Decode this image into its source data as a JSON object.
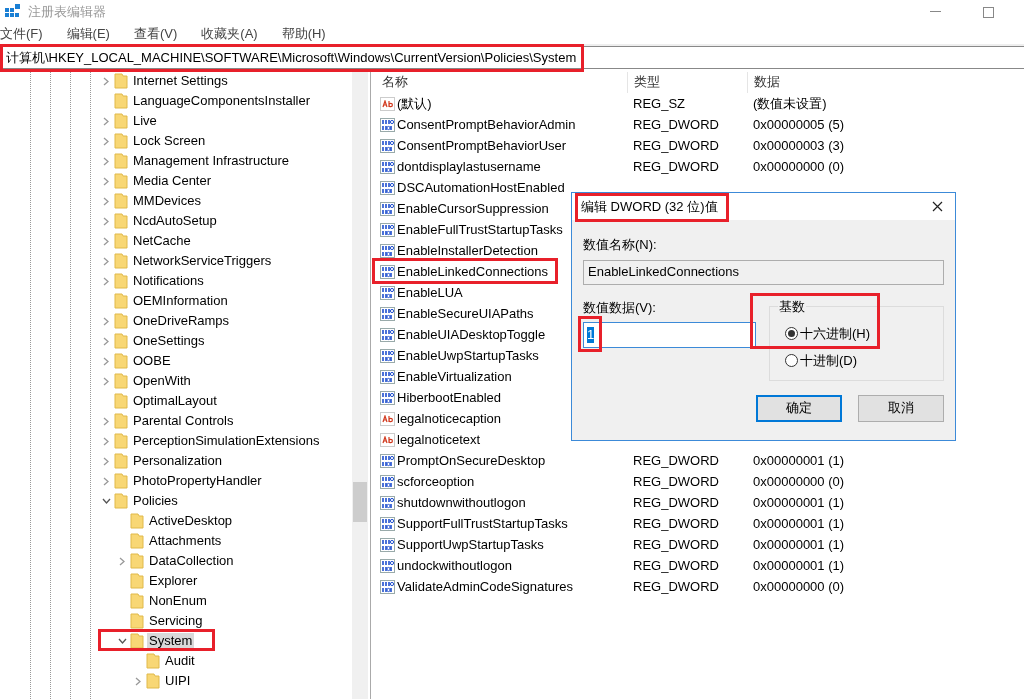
{
  "window": {
    "title": "注册表编辑器"
  },
  "menu": [
    "文件(F)",
    "编辑(E)",
    "查看(V)",
    "收藏夹(A)",
    "帮助(H)"
  ],
  "address": "计算机\\HKEY_LOCAL_MACHINE\\SOFTWARE\\Microsoft\\Windows\\CurrentVersion\\Policies\\System",
  "tree": [
    {
      "label": "Internet Settings",
      "expandable": true,
      "expanded": false,
      "selected": false
    },
    {
      "label": "LanguageComponentsInstaller",
      "expandable": false,
      "expanded": false,
      "selected": false
    },
    {
      "label": "Live",
      "expandable": true,
      "expanded": false,
      "selected": false
    },
    {
      "label": "Lock Screen",
      "expandable": true,
      "expanded": false,
      "selected": false
    },
    {
      "label": "Management Infrastructure",
      "expandable": true,
      "expanded": false,
      "selected": false
    },
    {
      "label": "Media Center",
      "expandable": true,
      "expanded": false,
      "selected": false
    },
    {
      "label": "MMDevices",
      "expandable": true,
      "expanded": false,
      "selected": false
    },
    {
      "label": "NcdAutoSetup",
      "expandable": true,
      "expanded": false,
      "selected": false
    },
    {
      "label": "NetCache",
      "expandable": true,
      "expanded": false,
      "selected": false
    },
    {
      "label": "NetworkServiceTriggers",
      "expandable": true,
      "expanded": false,
      "selected": false
    },
    {
      "label": "Notifications",
      "expandable": true,
      "expanded": false,
      "selected": false
    },
    {
      "label": "OEMInformation",
      "expandable": false,
      "expanded": false,
      "selected": false
    },
    {
      "label": "OneDriveRamps",
      "expandable": true,
      "expanded": false,
      "selected": false
    },
    {
      "label": "OneSettings",
      "expandable": true,
      "expanded": false,
      "selected": false
    },
    {
      "label": "OOBE",
      "expandable": true,
      "expanded": false,
      "selected": false
    },
    {
      "label": "OpenWith",
      "expandable": true,
      "expanded": false,
      "selected": false
    },
    {
      "label": "OptimalLayout",
      "expandable": false,
      "expanded": false,
      "selected": false
    },
    {
      "label": "Parental Controls",
      "expandable": true,
      "expanded": false,
      "selected": false
    },
    {
      "label": "PerceptionSimulationExtensions",
      "expandable": true,
      "expanded": false,
      "selected": false
    },
    {
      "label": "Personalization",
      "expandable": true,
      "expanded": false,
      "selected": false
    },
    {
      "label": "PhotoPropertyHandler",
      "expandable": true,
      "expanded": false,
      "selected": false
    },
    {
      "label": "Policies",
      "expandable": true,
      "expanded": true,
      "selected": false,
      "children": [
        {
          "label": "ActiveDesktop",
          "expandable": false,
          "expanded": false,
          "selected": false
        },
        {
          "label": "Attachments",
          "expandable": false,
          "expanded": false,
          "selected": false
        },
        {
          "label": "DataCollection",
          "expandable": true,
          "expanded": false,
          "selected": false
        },
        {
          "label": "Explorer",
          "expandable": false,
          "expanded": false,
          "selected": false
        },
        {
          "label": "NonEnum",
          "expandable": false,
          "expanded": false,
          "selected": false
        },
        {
          "label": "Servicing",
          "expandable": false,
          "expanded": false,
          "selected": false
        },
        {
          "label": "System",
          "expandable": true,
          "expanded": true,
          "selected": true,
          "children": [
            {
              "label": "Audit",
              "expandable": false,
              "expanded": false,
              "selected": false
            },
            {
              "label": "UIPI",
              "expandable": true,
              "expanded": false,
              "selected": false
            }
          ]
        }
      ]
    }
  ],
  "list": {
    "columns": [
      "名称",
      "类型",
      "数据"
    ],
    "rows": [
      {
        "kind": "string",
        "name": "(默认)",
        "type": "REG_SZ",
        "data": "(数值未设置)"
      },
      {
        "kind": "binary",
        "name": "ConsentPromptBehaviorAdmin",
        "type": "REG_DWORD",
        "data": "0x00000005 (5)"
      },
      {
        "kind": "binary",
        "name": "ConsentPromptBehaviorUser",
        "type": "REG_DWORD",
        "data": "0x00000003 (3)"
      },
      {
        "kind": "binary",
        "name": "dontdisplaylastusername",
        "type": "REG_DWORD",
        "data": "0x00000000 (0)"
      },
      {
        "kind": "binary",
        "name": "DSCAutomationHostEnabled"
      },
      {
        "kind": "binary",
        "name": "EnableCursorSuppression"
      },
      {
        "kind": "binary",
        "name": "EnableFullTrustStartupTasks"
      },
      {
        "kind": "binary",
        "name": "EnableInstallerDetection"
      },
      {
        "kind": "binary",
        "name": "EnableLinkedConnections"
      },
      {
        "kind": "binary",
        "name": "EnableLUA"
      },
      {
        "kind": "binary",
        "name": "EnableSecureUIAPaths"
      },
      {
        "kind": "binary",
        "name": "EnableUIADesktopToggle"
      },
      {
        "kind": "binary",
        "name": "EnableUwpStartupTasks"
      },
      {
        "kind": "binary",
        "name": "EnableVirtualization"
      },
      {
        "kind": "binary",
        "name": "HiberbootEnabled"
      },
      {
        "kind": "string",
        "name": "legalnoticecaption"
      },
      {
        "kind": "string",
        "name": "legalnoticetext"
      },
      {
        "kind": "binary",
        "name": "PromptOnSecureDesktop",
        "type": "REG_DWORD",
        "data": "0x00000001 (1)"
      },
      {
        "kind": "binary",
        "name": "scforceoption",
        "type": "REG_DWORD",
        "data": "0x00000000 (0)"
      },
      {
        "kind": "binary",
        "name": "shutdownwithoutlogon",
        "type": "REG_DWORD",
        "data": "0x00000001 (1)"
      },
      {
        "kind": "binary",
        "name": "SupportFullTrustStartupTasks",
        "type": "REG_DWORD",
        "data": "0x00000001 (1)"
      },
      {
        "kind": "binary",
        "name": "SupportUwpStartupTasks",
        "type": "REG_DWORD",
        "data": "0x00000001 (1)"
      },
      {
        "kind": "binary",
        "name": "undockwithoutlogon",
        "type": "REG_DWORD",
        "data": "0x00000001 (1)"
      },
      {
        "kind": "binary",
        "name": "ValidateAdminCodeSignatures",
        "type": "REG_DWORD",
        "data": "0x00000000 (0)"
      }
    ]
  },
  "dialog": {
    "title": "编辑 DWORD (32 位)值",
    "name_label": "数值名称(N):",
    "name_value": "EnableLinkedConnections",
    "data_label": "数值数据(V):",
    "data_value": "1",
    "base_label": "基数",
    "bases": [
      {
        "label": "十六进制(H)",
        "selected": true
      },
      {
        "label": "十进制(D)",
        "selected": false
      }
    ],
    "buttons": [
      {
        "label": "确定",
        "default": true
      },
      {
        "label": "取消",
        "default": false
      }
    ]
  }
}
